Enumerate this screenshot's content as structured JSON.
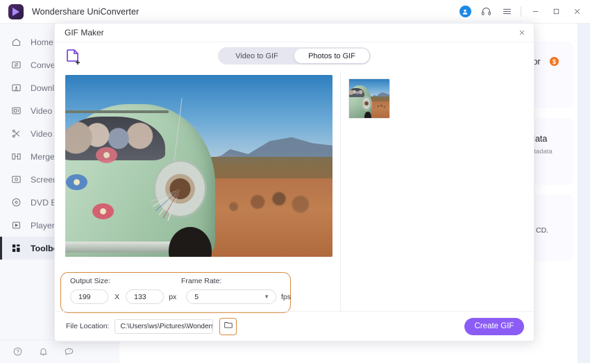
{
  "titlebar": {
    "app_title": "Wondershare UniConverter",
    "icons": {
      "account": "account-icon",
      "support": "headset-icon",
      "menu": "hamburger-icon",
      "minimize": "minimize-icon",
      "maximize": "maximize-icon",
      "close": "close-icon"
    }
  },
  "sidebar": {
    "items": [
      {
        "label": "Home",
        "icon": "home-icon",
        "active": false
      },
      {
        "label": "Converter",
        "icon": "convert-icon",
        "active": false
      },
      {
        "label": "Downloader",
        "icon": "download-icon",
        "active": false
      },
      {
        "label": "Video Compressor",
        "icon": "video-compress-icon",
        "active": false
      },
      {
        "label": "Video Editor",
        "icon": "scissors-icon",
        "active": false
      },
      {
        "label": "Merger",
        "icon": "merge-icon",
        "active": false
      },
      {
        "label": "Screen Recorder",
        "icon": "record-icon",
        "active": false
      },
      {
        "label": "DVD Burner",
        "icon": "disc-icon",
        "active": false
      },
      {
        "label": "Player",
        "icon": "play-icon",
        "active": false
      },
      {
        "label": "Toolbox",
        "icon": "toolbox-icon",
        "active": true
      }
    ],
    "bottom_icons": [
      {
        "name": "help-icon"
      },
      {
        "name": "notification-bell-icon"
      },
      {
        "name": "feedback-icon"
      }
    ]
  },
  "background": {
    "card_1": {
      "title_fragment": "tor",
      "badge": "$"
    },
    "card_2": {
      "title_fragment": "data",
      "sub_fragment": "etadata"
    },
    "card_3": {
      "title_fragment": "CD."
    }
  },
  "modal": {
    "title": "GIF Maker",
    "close_icon": "close-icon",
    "add_file_icon": "add-file-icon",
    "tabs": [
      {
        "label": "Video to GIF",
        "active": false
      },
      {
        "label": "Photos to GIF",
        "active": true
      }
    ],
    "settings": {
      "output_size_label": "Output Size:",
      "frame_rate_label": "Frame Rate:",
      "width": "199",
      "x_separator": "X",
      "height": "133",
      "px_unit": "px",
      "fps_value": "5",
      "fps_unit": "fps",
      "fps_caret_icon": "chevron-down-icon"
    },
    "footer": {
      "file_location_label": "File Location:",
      "file_location_value": "C:\\Users\\ws\\Pictures\\Wonders",
      "file_location_caret_icon": "chevron-down-icon",
      "browse_icon": "folder-icon",
      "create_button": "Create GIF"
    }
  },
  "colors": {
    "accent_purple": "#8b5cf6",
    "highlight_orange": "#d98a3e",
    "avatar_blue": "#1e88e5",
    "pro_badge_orange": "#f0761f"
  }
}
